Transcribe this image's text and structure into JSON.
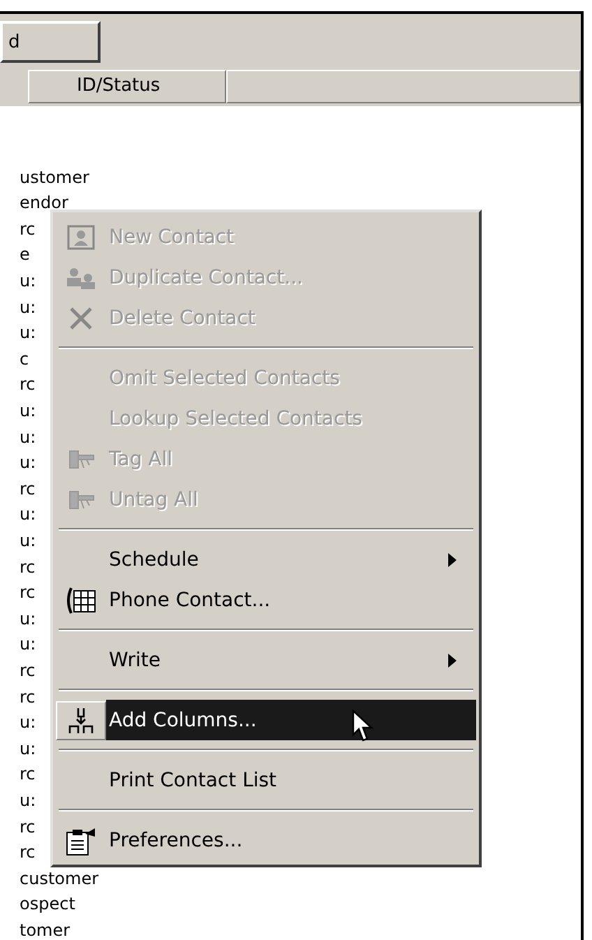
{
  "toolbar": {
    "button": "d"
  },
  "table": {
    "columns": [
      "ID/Status"
    ],
    "rows": [
      "ustomer",
      "endor",
      "rc",
      "e",
      "u:",
      "u:",
      "u:",
      "c",
      "rc",
      "u:",
      "u:",
      "u:",
      "rc",
      "u:",
      "u:",
      "rc",
      "rc",
      "u:",
      "u:",
      "rc",
      "rc",
      "u:",
      "u:",
      "rc",
      "u:",
      "rc",
      "rc",
      "customer",
      "ospect",
      "tomer"
    ]
  },
  "context_menu": [
    {
      "kind": "item",
      "label": "New Contact",
      "disabled": true,
      "selected": false,
      "submenu": false
    },
    {
      "kind": "item",
      "label": "Duplicate Contact...",
      "disabled": true,
      "selected": false,
      "submenu": false
    },
    {
      "kind": "item",
      "label": "Delete Contact",
      "disabled": true,
      "selected": false,
      "submenu": false
    },
    {
      "kind": "separator"
    },
    {
      "kind": "item",
      "label": "Omit Selected Contacts",
      "disabled": true,
      "selected": false,
      "submenu": false
    },
    {
      "kind": "item",
      "label": "Lookup Selected Contacts",
      "disabled": true,
      "selected": false,
      "submenu": false
    },
    {
      "kind": "item",
      "label": "Tag All",
      "disabled": true,
      "selected": false,
      "submenu": false
    },
    {
      "kind": "item",
      "label": "Untag All",
      "disabled": true,
      "selected": false,
      "submenu": false
    },
    {
      "kind": "separator"
    },
    {
      "kind": "item",
      "label": "Schedule",
      "disabled": false,
      "selected": false,
      "submenu": true
    },
    {
      "kind": "item",
      "label": "Phone Contact...",
      "disabled": false,
      "selected": false,
      "submenu": false
    },
    {
      "kind": "separator"
    },
    {
      "kind": "item",
      "label": "Write",
      "disabled": false,
      "selected": false,
      "submenu": true
    },
    {
      "kind": "separator"
    },
    {
      "kind": "item",
      "label": "Add Columns...",
      "disabled": false,
      "selected": true,
      "submenu": false
    },
    {
      "kind": "separator"
    },
    {
      "kind": "item",
      "label": "Print Contact List",
      "disabled": false,
      "selected": false,
      "submenu": false
    },
    {
      "kind": "separator"
    },
    {
      "kind": "item",
      "label": "Preferences...",
      "disabled": false,
      "selected": false,
      "submenu": false
    }
  ]
}
